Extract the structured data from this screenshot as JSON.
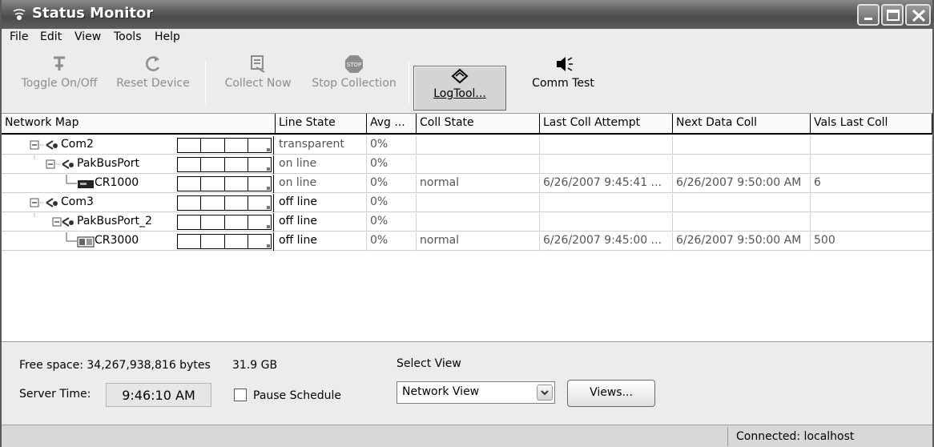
{
  "window": {
    "title": "Status Monitor"
  },
  "menu": [
    "File",
    "Edit",
    "View",
    "Tools",
    "Help"
  ],
  "toolbar": {
    "toggle": "Toggle On/Off",
    "reset": "Reset Device",
    "collect": "Collect Now",
    "stop": "Stop Collection",
    "logtool": "LogTool...",
    "commtest": "Comm Test"
  },
  "grid": {
    "columns": [
      "Network Map",
      "Line State",
      "Avg ...",
      "Coll State",
      "Last Coll Attempt",
      "Next Data Coll",
      "Vals Last Coll"
    ],
    "rows": [
      {
        "name": "Com2",
        "line_state": "transparent",
        "avg": "0%",
        "coll_state": "",
        "last_attempt": "",
        "next_coll": "",
        "vals": ""
      },
      {
        "name": "PakBusPort",
        "line_state": "on line",
        "avg": "0%",
        "coll_state": "",
        "last_attempt": "",
        "next_coll": "",
        "vals": ""
      },
      {
        "name": "CR1000",
        "line_state": "on line",
        "avg": "0%",
        "coll_state": "normal",
        "last_attempt": "6/26/2007 9:45:41 ...",
        "next_coll": "6/26/2007 9:50:00 AM",
        "vals": "6"
      },
      {
        "name": "Com3",
        "line_state": "off line",
        "avg": "0%",
        "coll_state": "",
        "last_attempt": "",
        "next_coll": "",
        "vals": ""
      },
      {
        "name": "PakBusPort_2",
        "line_state": "off line",
        "avg": "0%",
        "coll_state": "",
        "last_attempt": "",
        "next_coll": "",
        "vals": ""
      },
      {
        "name": "CR3000",
        "line_state": "off line",
        "avg": "0%",
        "coll_state": "normal",
        "last_attempt": "6/26/2007 9:45:00 ...",
        "next_coll": "6/26/2007 9:50:00 AM",
        "vals": "500"
      }
    ]
  },
  "panel": {
    "free_space_label": "Free space: 34,267,938,816 bytes",
    "free_space_gb": "31.9 GB",
    "server_time_label": "Server Time:",
    "server_time": "9:46:10 AM",
    "pause_label": "Pause Schedule",
    "select_view_label": "Select View",
    "select_view_value": "Network View",
    "views_button": "Views..."
  },
  "status": {
    "connection": "Connected: localhost"
  }
}
